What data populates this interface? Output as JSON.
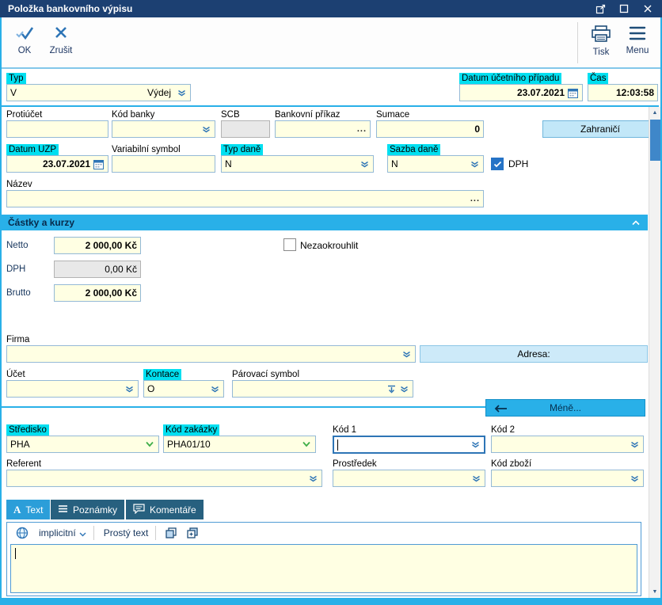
{
  "window": {
    "title": "Položka bankovního výpisu"
  },
  "toolbar": {
    "ok": "OK",
    "cancel": "Zrušit",
    "print": "Tisk",
    "menu": "Menu"
  },
  "ui": {
    "ellipsis": "..."
  },
  "row1": {
    "typ_label": "Typ",
    "typ_value": "V",
    "typ_display": "Výdej",
    "datum_label": "Datum účetního případu",
    "datum_value": "23.07.2021",
    "cas_label": "Čas",
    "cas_value": "12:03:58"
  },
  "row2": {
    "protiucet_label": "Protiúčet",
    "protiucet_value": "",
    "kod_banky_label": "Kód banky",
    "kod_banky_value": "",
    "scb_label": "SCB",
    "scb_value": "",
    "bankovni_prikaz_label": "Bankovní příkaz",
    "bankovni_prikaz_value": "",
    "sumace_label": "Sumace",
    "sumace_value": "0",
    "zahranici_button": "Zahraničí"
  },
  "row3": {
    "datum_uzp_label": "Datum UZP",
    "datum_uzp_value": "23.07.2021",
    "var_symbol_label": "Variabilní symbol",
    "var_symbol_value": "",
    "typ_dane_label": "Typ daně",
    "typ_dane_value": "N",
    "sazba_dane_label": "Sazba daně",
    "sazba_dane_value": "N",
    "dph_label": "DPH",
    "dph_checked": true
  },
  "row4": {
    "nazev_label": "Název",
    "nazev_value": ""
  },
  "amounts": {
    "header": "Částky a kurzy",
    "netto_label": "Netto",
    "netto_value": "2 000,00 Kč",
    "nezaokrouhlit_label": "Nezaokrouhlit",
    "nezaokrouhlit_checked": false,
    "dph_label": "DPH",
    "dph_value": "0,00 Kč",
    "brutto_label": "Brutto",
    "brutto_value": "2 000,00 Kč"
  },
  "firm": {
    "firma_label": "Firma",
    "firma_value": "",
    "adresa_label": "Adresa:",
    "ucet_label": "Účet",
    "ucet_value": "",
    "kontace_label": "Kontace",
    "kontace_value": "O",
    "parovaci_label": "Párovací symbol",
    "parovaci_value": "",
    "mene_button": "Méně..."
  },
  "codes": {
    "stredisko_label": "Středisko",
    "stredisko_value": "PHA",
    "kod_zakazky_label": "Kód zakázky",
    "kod_zakazky_value": "PHA01/10",
    "kod1_label": "Kód 1",
    "kod1_value": "",
    "kod2_label": "Kód 2",
    "kod2_value": "",
    "referent_label": "Referent",
    "referent_value": "",
    "prostredek_label": "Prostředek",
    "prostredek_value": "",
    "kod_zbozi_label": "Kód zboží",
    "kod_zbozi_value": ""
  },
  "tabs": [
    {
      "label": "Text",
      "active": true
    },
    {
      "label": "Poznámky",
      "active": false
    },
    {
      "label": "Komentáře",
      "active": false
    }
  ],
  "editor": {
    "language": "implicitní",
    "mode": "Prostý text",
    "content": ""
  },
  "colors": {
    "titlebar": "#1c4072",
    "label_highlight": "#00dff0",
    "field_bg": "#ffffe3",
    "accent": "#29b0e8",
    "focus_border": "#2e75b6",
    "tab_active": "#2b9ed9",
    "tab_inactive": "#27607f",
    "checkbox_checked": "#2573c6",
    "button_light": "#c2e7f8"
  }
}
